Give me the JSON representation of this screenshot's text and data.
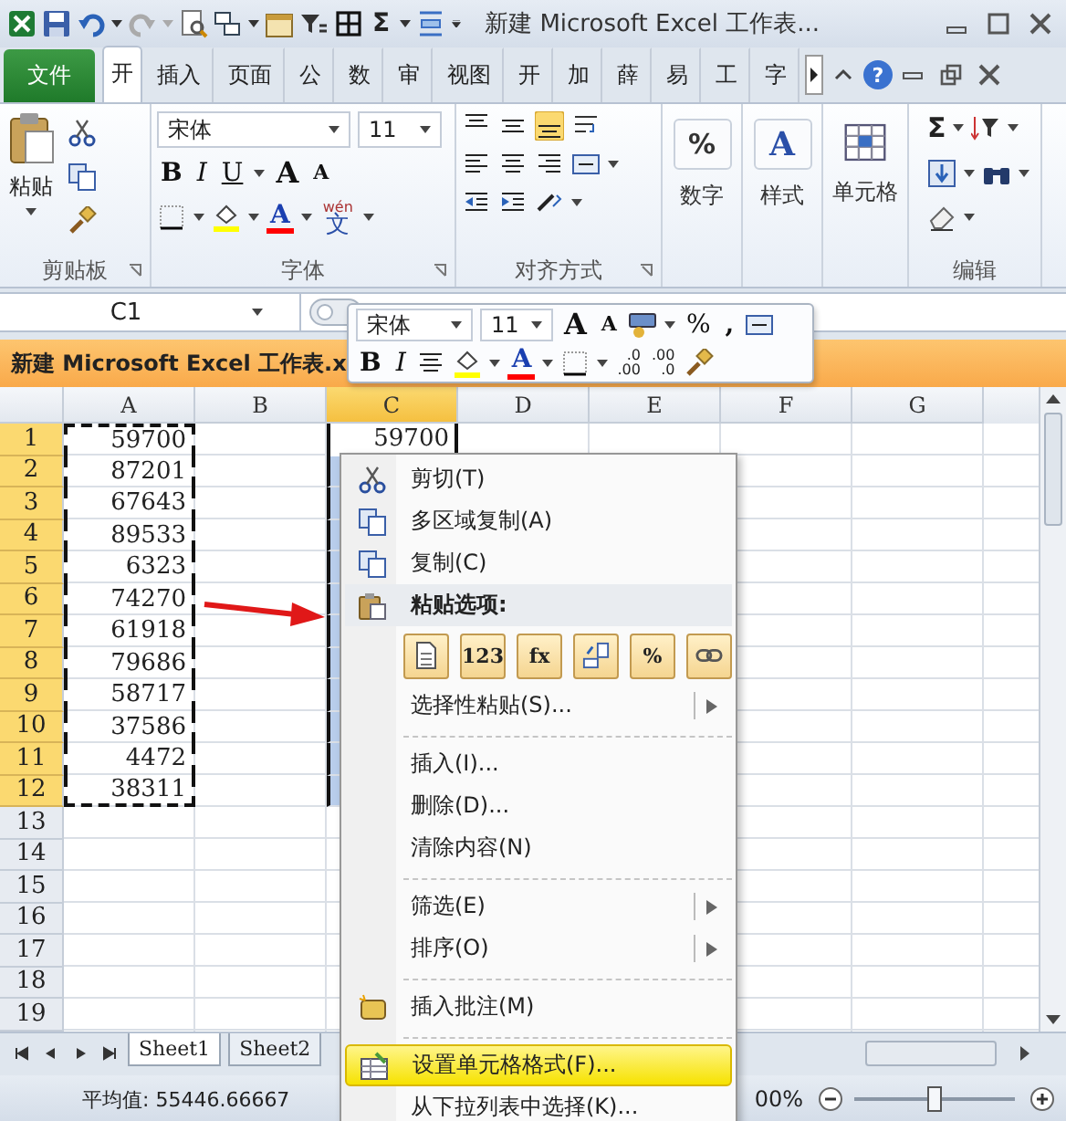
{
  "title_bar": {
    "title": "新建 Microsoft Excel 工作表...",
    "sum": "Σ"
  },
  "ribbon_tabs": [
    {
      "label": "文件",
      "kind": "file",
      "selected": false
    },
    {
      "label": "开",
      "kind": "tab",
      "selected": true
    },
    {
      "label": "插入",
      "kind": "tab",
      "selected": false
    },
    {
      "label": "页面",
      "kind": "tab",
      "selected": false
    },
    {
      "label": "公",
      "kind": "tab",
      "selected": false
    },
    {
      "label": "数",
      "kind": "tab",
      "selected": false
    },
    {
      "label": "审",
      "kind": "tab",
      "selected": false
    },
    {
      "label": "视图",
      "kind": "tab",
      "selected": false
    },
    {
      "label": "开",
      "kind": "tab",
      "selected": false
    },
    {
      "label": "加",
      "kind": "tab",
      "selected": false
    },
    {
      "label": "薛",
      "kind": "tab",
      "selected": false
    },
    {
      "label": "易",
      "kind": "tab",
      "selected": false
    },
    {
      "label": "工",
      "kind": "tab",
      "selected": false
    },
    {
      "label": "字",
      "kind": "tab",
      "selected": false
    }
  ],
  "help": "?",
  "ribbon": {
    "clipboard": {
      "label": "剪贴板",
      "paste": "粘贴"
    },
    "font": {
      "label": "字体",
      "font_name": "宋体",
      "font_size": "11",
      "bold": "B",
      "italic": "I",
      "underline": "U",
      "grow": "A",
      "shrink": "A",
      "font_color": "A",
      "phonetic_top": "wén",
      "phonetic": "文"
    },
    "alignment": {
      "label": "对齐方式"
    },
    "number": {
      "label": "数字",
      "glyph": "%"
    },
    "styles": {
      "label": "样式",
      "glyph": "A"
    },
    "cells": {
      "label": "单元格"
    },
    "editing": {
      "label": "编辑",
      "sum": "Σ"
    }
  },
  "formula_bar": {
    "name_box": "C1"
  },
  "workbook": {
    "title": "新建 Microsoft Excel 工作表.x"
  },
  "columns": [
    {
      "label": "A",
      "selected": false
    },
    {
      "label": "B",
      "selected": false
    },
    {
      "label": "C",
      "selected": true
    },
    {
      "label": "D",
      "selected": false
    },
    {
      "label": "E",
      "selected": false
    },
    {
      "label": "F",
      "selected": false
    },
    {
      "label": "G",
      "selected": false
    }
  ],
  "rows": [
    {
      "number": "1",
      "selected": true,
      "a": "59700",
      "c": "59700"
    },
    {
      "number": "2",
      "selected": true,
      "a": "87201"
    },
    {
      "number": "3",
      "selected": true,
      "a": "67643"
    },
    {
      "number": "4",
      "selected": true,
      "a": "89533"
    },
    {
      "number": "5",
      "selected": true,
      "a": "6323"
    },
    {
      "number": "6",
      "selected": true,
      "a": "74270"
    },
    {
      "number": "7",
      "selected": true,
      "a": "61918"
    },
    {
      "number": "8",
      "selected": true,
      "a": "79686"
    },
    {
      "number": "9",
      "selected": true,
      "a": "58717"
    },
    {
      "number": "10",
      "selected": true,
      "a": "37586"
    },
    {
      "number": "11",
      "selected": true,
      "a": "4472"
    },
    {
      "number": "12",
      "selected": true,
      "a": "38311"
    },
    {
      "number": "13",
      "selected": false
    },
    {
      "number": "14",
      "selected": false
    },
    {
      "number": "15",
      "selected": false
    },
    {
      "number": "16",
      "selected": false
    },
    {
      "number": "17",
      "selected": false
    },
    {
      "number": "18",
      "selected": false
    },
    {
      "number": "19",
      "selected": false
    }
  ],
  "sheet_tabs": [
    {
      "label": "Sheet1",
      "selected": true
    },
    {
      "label": "Sheet2",
      "selected": false
    }
  ],
  "status_bar": {
    "average": "平均值: 55446.66667",
    "zoom": "00%",
    "zoom_slider": {
      "level": 0.5
    }
  },
  "mini_toolbar": {
    "font_name": "宋体",
    "font_size": "11",
    "grow": "A",
    "shrink": "A",
    "percent": "%",
    "comma": ",",
    "bold": "B",
    "italic": "I",
    "font_color": "A",
    "decimals": [
      [
        ".0",
        ".00"
      ],
      [
        ".00",
        ".0"
      ]
    ]
  },
  "context_menu": [
    {
      "kind": "item",
      "label": "剪切(T)",
      "submenu": false,
      "selected": false
    },
    {
      "kind": "item",
      "label": "多区域复制(A)",
      "submenu": false,
      "selected": false
    },
    {
      "kind": "item",
      "label": "复制(C)",
      "submenu": false,
      "selected": false
    },
    {
      "kind": "header",
      "label": "粘贴选项:"
    },
    {
      "kind": "paste_options",
      "options": [
        {
          "kind": "plain"
        },
        {
          "kind": "text",
          "text": "123"
        },
        {
          "kind": "text",
          "text": "fx"
        },
        {
          "kind": "transpose"
        },
        {
          "kind": "text",
          "text": "%"
        },
        {
          "kind": "link"
        }
      ]
    },
    {
      "kind": "item",
      "label": "选择性粘贴(S)...",
      "submenu": true,
      "selected": false
    },
    {
      "kind": "separator"
    },
    {
      "kind": "item",
      "label": "插入(I)...",
      "submenu": false,
      "selected": false
    },
    {
      "kind": "item",
      "label": "删除(D)...",
      "submenu": false,
      "selected": false
    },
    {
      "kind": "item",
      "label": "清除内容(N)",
      "submenu": false,
      "selected": false
    },
    {
      "kind": "separator"
    },
    {
      "kind": "item",
      "label": "筛选(E)",
      "submenu": true,
      "selected": false
    },
    {
      "kind": "item",
      "label": "排序(O)",
      "submenu": true,
      "selected": false
    },
    {
      "kind": "separator"
    },
    {
      "kind": "item",
      "label": "插入批注(M)",
      "submenu": false,
      "selected": false
    },
    {
      "kind": "separator"
    },
    {
      "kind": "item",
      "label": "设置单元格格式(F)...",
      "submenu": false,
      "selected": true
    },
    {
      "kind": "item",
      "label": "从下拉列表中选择(K)...",
      "submenu": false,
      "selected": false
    }
  ]
}
